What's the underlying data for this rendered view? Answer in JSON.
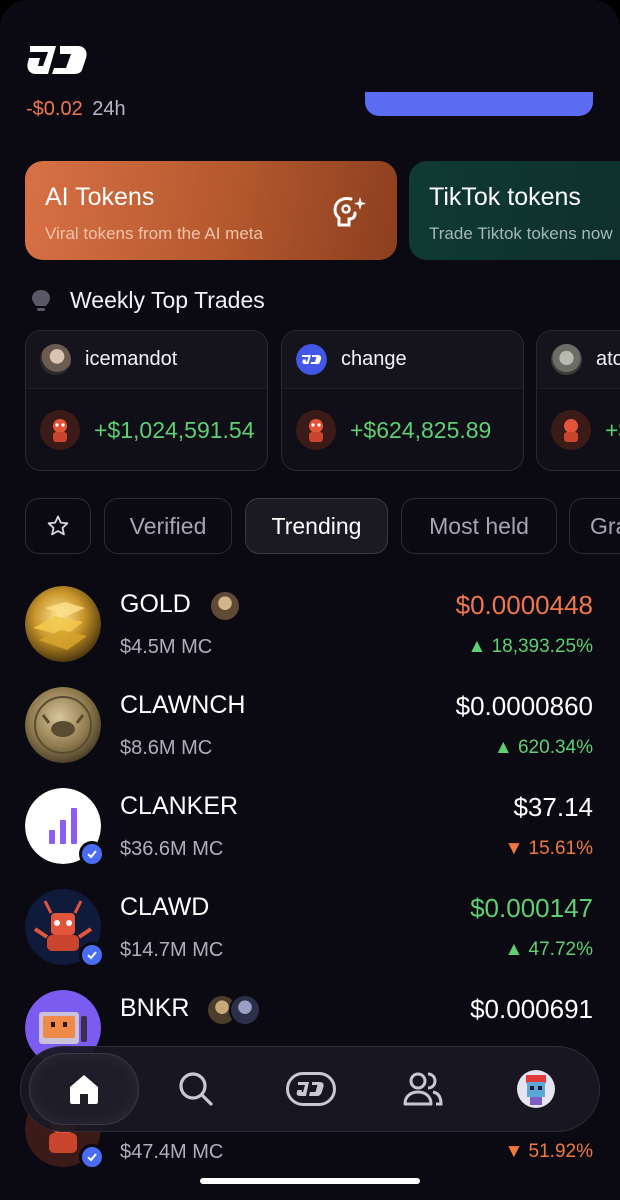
{
  "header": {
    "pnl_value": "-$0.02",
    "pnl_period": "24h"
  },
  "categories": [
    {
      "title": "AI Tokens",
      "subtitle": "Viral tokens from the AI meta"
    },
    {
      "title": "TikTok tokens",
      "subtitle": "Trade Tiktok tokens now"
    }
  ],
  "weekly": {
    "title": "Weekly Top Trades",
    "trades": [
      {
        "user": "icemandot",
        "amount": "+$1,024,591.54"
      },
      {
        "user": "change",
        "amount": "+$624,825.89"
      },
      {
        "user": "atc",
        "amount": "+$"
      }
    ]
  },
  "filters": {
    "verified": "Verified",
    "trending": "Trending",
    "most_held": "Most held",
    "more": "Gra"
  },
  "tokens": [
    {
      "name": "GOLD",
      "mc": "$4.5M MC",
      "price": "$0.0000448",
      "change": "▲ 18,393.25%",
      "price_color": "#f0774d"
    },
    {
      "name": "CLAWNCH",
      "mc": "$8.6M MC",
      "price": "$0.0000860",
      "change": "▲ 620.34%",
      "price_color": "#ffffff"
    },
    {
      "name": "CLANKER",
      "mc": "$36.6M MC",
      "price": "$37.14",
      "change": "▼ 15.61%",
      "price_color": "#ffffff"
    },
    {
      "name": "CLAWD",
      "mc": "$14.7M MC",
      "price": "$0.000147",
      "change": "▲ 47.72%",
      "price_color": "#5fcf74"
    },
    {
      "name": "BNKR",
      "mc": "",
      "price": "$0.000691",
      "change": "",
      "price_color": "#ffffff"
    },
    {
      "name": "",
      "mc": "$47.4M MC",
      "price": "",
      "change": "▼ 51.92%",
      "price_color": "#ffffff"
    }
  ],
  "colors": {
    "accent_blue": "#5b6cf3",
    "up_green": "#5fcf74",
    "down_orange": "#f07a3c",
    "ai_card": "#c8653a",
    "tiktok_card": "#0f3a34"
  },
  "icons": [
    "logo-icon",
    "ai-sparkle-icon",
    "lightbulb-icon",
    "star-icon",
    "home-icon",
    "search-icon",
    "token-icon",
    "people-icon",
    "profile-avatar-icon",
    "verified-icon"
  ]
}
